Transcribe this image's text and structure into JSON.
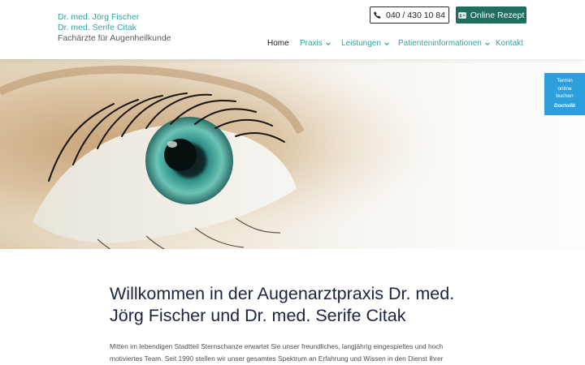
{
  "logo": {
    "doctor1": "Dr. med. Jörg Fischer",
    "doctor2": "Dr. med. Serife Citak",
    "subtitle": "Fachärzte für Augenheilkunde"
  },
  "header": {
    "phone": "040 / 430 10 84",
    "rezept": "Online Rezept"
  },
  "nav": {
    "items": [
      {
        "label": "Home",
        "active": true
      },
      {
        "label": "Praxis",
        "dropdown": true
      },
      {
        "label": "Leistungen",
        "dropdown": true
      },
      {
        "label": "Patienteninformationen",
        "dropdown": true
      },
      {
        "label": "Kontakt"
      }
    ]
  },
  "termin": {
    "line1": "Termin",
    "line2": "online",
    "line3": "buchen",
    "brand": "Doctolib"
  },
  "main": {
    "title_line1": "Willkommen in der Augenarztpraxis Dr. med.",
    "title_line2": "Jörg Fischer und Dr. med. Serife Citak",
    "intro": "Mitten im lebendigen Stadtteil Sternschanze erwartet Sie unser freundliches, langjährig eingespieltes und hoch motiviertes Team. Seit 1990 stellen wir unser gesamtes Spektrum an Erfahrung und Wissen in den Dienst Ihrer Gesundheit."
  },
  "colors": {
    "accent": "#2aa7a0",
    "button_green": "#1f6e5e",
    "doctolib_blue": "#2d9fdc",
    "title": "#1b2340"
  },
  "hero": {
    "icon": "eye-closeup-photo"
  }
}
